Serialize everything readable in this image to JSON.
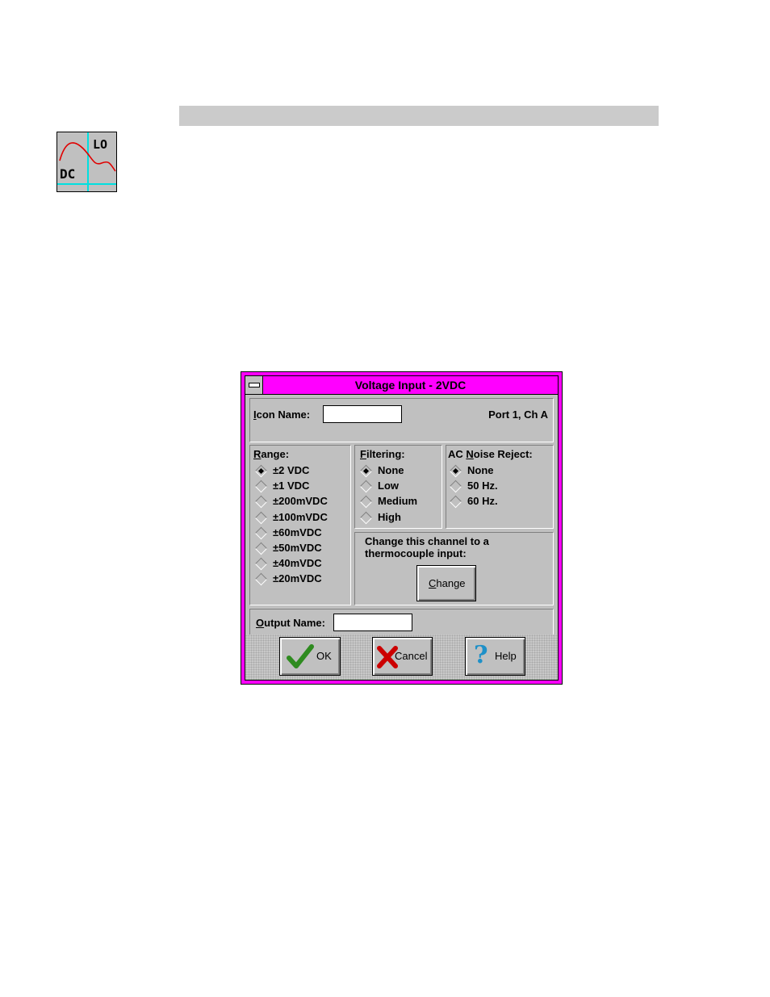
{
  "dialog": {
    "title": "Voltage Input - 2VDC",
    "icon_name_label_u": "I",
    "icon_name_label_rest": "con Name:",
    "icon_name_value": "",
    "port_text": "Port 1, Ch A",
    "range": {
      "label_u": "R",
      "label_rest": "ange:",
      "options": [
        "±2 VDC",
        "±1 VDC",
        "±200mVDC",
        "±100mVDC",
        "±60mVDC",
        "±50mVDC",
        "±40mVDC",
        "±20mVDC"
      ],
      "selected_index": 0
    },
    "filtering": {
      "label_u": "F",
      "label_rest": "iltering:",
      "options": [
        "None",
        "Low",
        "Medium",
        "High"
      ],
      "selected_index": 0
    },
    "ac_noise": {
      "label_pre": "AC ",
      "label_u": "N",
      "label_rest": "oise Reject:",
      "options": [
        "None",
        "50 Hz.",
        "60 Hz."
      ],
      "selected_index": 0
    },
    "change_text_line1": "Change this channel to a",
    "change_text_line2": "thermocouple input:",
    "change_button_u": "C",
    "change_button_rest": "hange",
    "output_name_label_u": "O",
    "output_name_label_rest": "utput Name:",
    "output_name_value": "",
    "ok_label": "OK",
    "cancel_label": "Cancel",
    "help_label": "Help"
  },
  "icon": {
    "top_text": "LO",
    "bottom_text": "DC"
  },
  "colors": {
    "title_bar": "#ff00ff",
    "dialog_face": "#c0c0c0",
    "ok_check": "#2e8b1f",
    "cancel_x": "#cc0000",
    "help_q": "#1e90c8"
  }
}
